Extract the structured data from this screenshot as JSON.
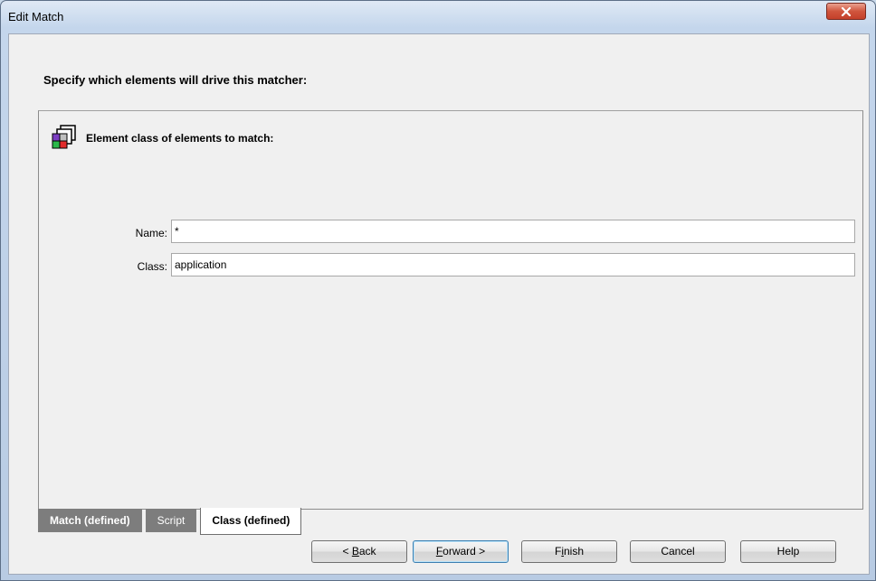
{
  "window": {
    "title": "Edit Match"
  },
  "heading": "Specify which elements will drive this matcher:",
  "section": {
    "label": "Element class of elements to match:",
    "icon": "element-class-icon"
  },
  "fields": {
    "name_label": "Name:",
    "name_value": "*",
    "class_label": "Class:",
    "class_value": "application"
  },
  "tabs": [
    {
      "label": "Match (defined)"
    },
    {
      "label": "Script"
    },
    {
      "label": "Class (defined)",
      "active": true
    }
  ],
  "buttons": {
    "back": {
      "prefix": "< ",
      "mnemonic": "B",
      "rest": "ack"
    },
    "forward": {
      "prefix": "",
      "mnemonic": "F",
      "rest": "orward >"
    },
    "finish": {
      "prefix": "F",
      "mnemonic": "i",
      "rest": "nish"
    },
    "cancel": "Cancel",
    "help": "Help"
  }
}
